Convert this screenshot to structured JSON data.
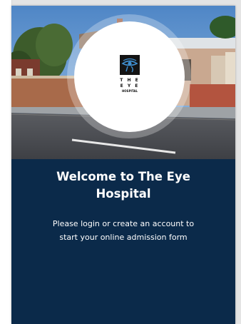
{
  "logo": {
    "line1": "T H E",
    "line2": "E Y E",
    "line3": "HOSPITAL",
    "icon": "eye-of-horus-icon"
  },
  "welcome": {
    "title_line1": "Welcome to The Eye",
    "title_line2": "Hospital",
    "subtitle_line1": "Please login or create an account to",
    "subtitle_line2": "start your online admission form"
  },
  "colors": {
    "panel_background": "#0b2a4a",
    "text": "#ffffff",
    "logo_circle": "#ffffff"
  }
}
